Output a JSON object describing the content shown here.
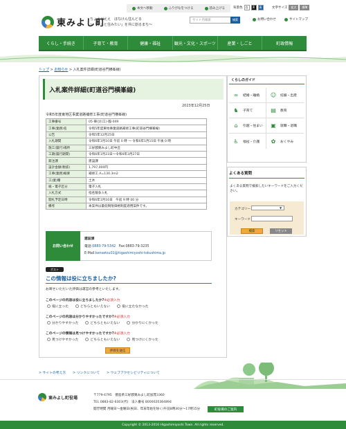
{
  "util": {
    "main_link": "本文へ移動",
    "furigana": "ふりがなをつける",
    "read_aloud": "読み上げる"
  },
  "bg_color": {
    "label": "背景色",
    "options": [
      "白",
      "黒",
      "青"
    ]
  },
  "font_size": {
    "label": "文字サイズ",
    "options": [
      "拡大",
      "標準"
    ]
  },
  "header": {
    "logo": "東みよし町",
    "tagline_1": "ちょうどええ　ほなけん住んどる",
    "tagline_2": "〜「ずっと住みたい」を共に創るまち〜"
  },
  "search": {
    "placeholder": "サイト内検索",
    "button": "検索"
  },
  "links": {
    "contact": "お問い合わせ",
    "sitemap": "サイトマップ"
  },
  "nav": [
    "くらし・手続き",
    "子育て・教育",
    "健康・福祉",
    "観光・文化・スポーツ",
    "産業・しごと",
    "町政情報"
  ],
  "breadcrumb": {
    "top": "トップ",
    "news": "お知らせ",
    "current": "入札案件詳細(町道谷門横峯線)"
  },
  "page": {
    "title": "入札案件詳細(町道谷門横峯線)",
    "date": "2023年12月25日",
    "subject": "令和5年度東地区事業道路補修工事(町道谷門横峯線)",
    "rows": [
      [
        "工事番号",
        "05-東(災(工)-臨-049"
      ],
      [
        "工事(業務)名",
        "令和5年度東地事業道路補修工事(町道谷門横峯線)"
      ],
      [
        "公告",
        "令和5年12月25日"
      ],
      [
        "入札期間",
        "令和6年1月10日 午前 0 時 〜 令和6年1月15日 午後 0 時"
      ],
      [
        "施工(履行)場所",
        "三好郡東みよし町中庄"
      ],
      [
        "工期(履行期間)",
        "令和6年1月23日〜令和6年3月27日"
      ],
      [
        "発注課",
        "建設課"
      ],
      [
        "設計金額(税抜)",
        "1,797,000円"
      ],
      [
        "工事(業務)概要",
        "補修工 A=130.3m2"
      ],
      [
        "工(業)種",
        "土木"
      ],
      [
        "紙・電子区分",
        "電子入札"
      ],
      [
        "入札方式",
        "指名競争入札"
      ],
      [
        "開札予定日時",
        "令和6年1月16日　午前 9 時 00 分"
      ],
      [
        "備考",
        "本案件は最低制限価格制度適用案件です。"
      ]
    ]
  },
  "contact": {
    "label": "お問い合わせ",
    "dept": "建設課",
    "phone_label": "電話:",
    "phone": "0883-79-5342",
    "fax": "Fax:0883-79-3235",
    "email_label": "E-Mail:",
    "email": "kensetsu01@higashimiyoshi-tokushima.jp"
  },
  "tweet": "ポスト",
  "feedback": {
    "title": "この情報は役に立ちましたか?",
    "intro": "お寄せいただいた評価は運営の参考といたします。",
    "required": "※必須入力",
    "q1": "このページの内容は役に立ちましたか?",
    "q1_opts": [
      "役に立った",
      "どちらともいえない",
      "役に立たなかった"
    ],
    "q2": "このページの内容は分かりやすかったですか?",
    "q2_opts": [
      "分かりやすかった",
      "どちらともいえない",
      "分かりにくかった"
    ],
    "q3": "このページの情報は見つけやすかったですか?",
    "q3_opts": [
      "見つけやすかった",
      "どちらともいえない",
      "見つけにくかった"
    ],
    "submit": "評価を送信"
  },
  "guide": {
    "title": "くらしのガイド",
    "items": [
      {
        "label": "結婚・離婚",
        "icon": "rings-icon"
      },
      {
        "label": "妊娠・出産",
        "icon": "baby-icon"
      },
      {
        "label": "子育て",
        "icon": "child-icon"
      },
      {
        "label": "教育",
        "icon": "book-icon"
      },
      {
        "label": "引越・住まい",
        "icon": "house-icon"
      },
      {
        "label": "就職・退職",
        "icon": "briefcase-icon"
      },
      {
        "label": "福祉・介護",
        "icon": "wheelchair-icon"
      },
      {
        "label": "おくやみ",
        "icon": "flower-icon"
      }
    ]
  },
  "faq": {
    "title": "よくある質問",
    "desc": "よくある質問で検索したいキーワードをご入力ください。",
    "category": "カテゴリー",
    "keyword": "キーワード",
    "search": "検索",
    "reset": "リセット"
  },
  "footer": {
    "links": [
      "サイトの考え方",
      "リンクについて",
      "ウェブアクセシビリティについて"
    ],
    "name": "東みよし町役場",
    "zip": "〒779-4795　徳島県三好郡東みよし町加茂3360",
    "tel": "TEL 0883-82-6303(代)　法人番号 8000020364894",
    "hours": "開庁時間 月曜日〜金曜日(祝日、年末年始を除く)午前8時30分〜17時15分",
    "guide_btn": "町役場のご案内",
    "copyright": "Copyright © 2013-2016 Higashimiyoshi Town. All rights reserved."
  },
  "colors": {
    "green": "#2e8b3a",
    "orange": "#f2a93b",
    "blue": "#1b5e9e"
  }
}
